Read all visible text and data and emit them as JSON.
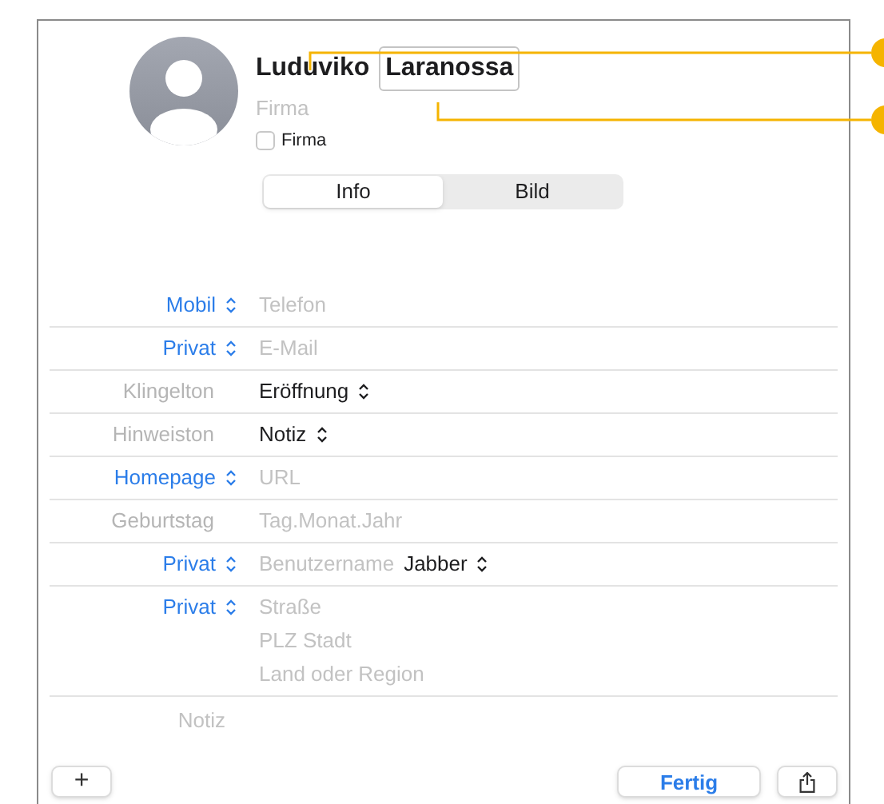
{
  "contact": {
    "first_name": "Luduviko",
    "last_name": "Laranossa",
    "company_placeholder": "Firma",
    "company_checkbox": {
      "label": "Firma",
      "checked": false
    }
  },
  "tabs": [
    {
      "label": "Info",
      "selected": true
    },
    {
      "label": "Bild",
      "selected": false
    }
  ],
  "rows": [
    {
      "label": "Mobil",
      "kind": "popup",
      "lines": [
        [
          {
            "text": "Telefon",
            "kind": "placeholder"
          }
        ]
      ]
    },
    {
      "label": "Privat",
      "kind": "popup",
      "lines": [
        [
          {
            "text": "E-Mail",
            "kind": "placeholder"
          }
        ]
      ]
    },
    {
      "label": "Klingelton",
      "kind": "static",
      "lines": [
        [
          {
            "text": "Eröffnung",
            "kind": "popup"
          }
        ]
      ]
    },
    {
      "label": "Hinweiston",
      "kind": "static",
      "lines": [
        [
          {
            "text": "Notiz",
            "kind": "popup"
          }
        ]
      ]
    },
    {
      "label": "Homepage",
      "kind": "popup",
      "lines": [
        [
          {
            "text": "URL",
            "kind": "placeholder"
          }
        ]
      ]
    },
    {
      "label": "Geburtstag",
      "kind": "static",
      "lines": [
        [
          {
            "text": "Tag.Monat.Jahr",
            "kind": "placeholder"
          }
        ]
      ]
    },
    {
      "label": "Privat",
      "kind": "popup",
      "lines": [
        [
          {
            "text": "Benutzername",
            "kind": "placeholder"
          },
          {
            "text": "Jabber",
            "kind": "popup"
          }
        ]
      ]
    },
    {
      "label": "Privat",
      "kind": "popup",
      "lines": [
        [
          {
            "text": "Straße",
            "kind": "placeholder"
          }
        ],
        [
          {
            "text": "PLZ Stadt",
            "kind": "placeholder"
          }
        ],
        [
          {
            "text": "Land oder Region",
            "kind": "placeholder"
          }
        ]
      ]
    }
  ],
  "note": {
    "placeholder": "Notiz"
  },
  "buttons": {
    "add": "+",
    "done": "Fertig"
  }
}
